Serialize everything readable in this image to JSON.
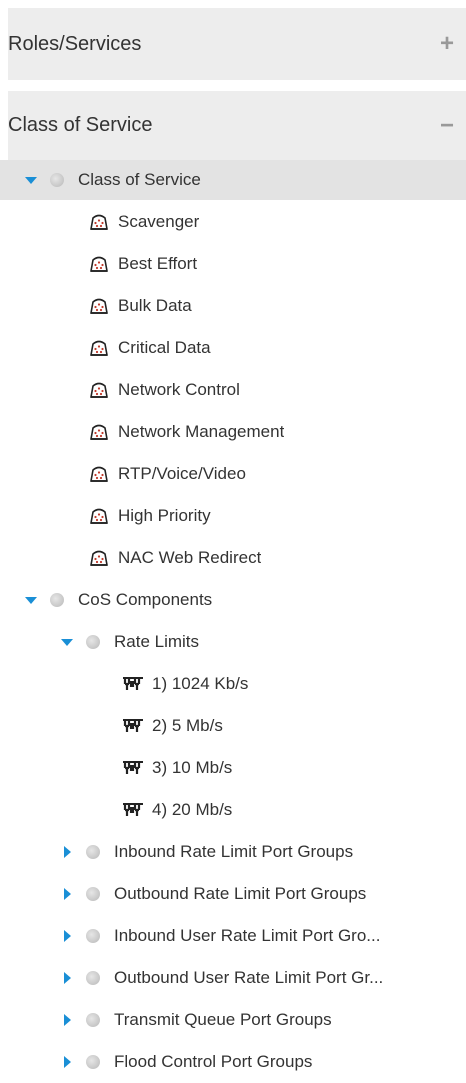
{
  "panels": {
    "roles_services": {
      "title": "Roles/Services",
      "toggle": "+"
    },
    "class_of_service": {
      "title": "Class of Service",
      "toggle": "−"
    }
  },
  "tree": {
    "cos_root": {
      "label": "Class of Service"
    },
    "cos_items": [
      {
        "label": "Scavenger"
      },
      {
        "label": "Best Effort"
      },
      {
        "label": "Bulk Data"
      },
      {
        "label": "Critical Data"
      },
      {
        "label": "Network Control"
      },
      {
        "label": "Network Management"
      },
      {
        "label": "RTP/Voice/Video"
      },
      {
        "label": "High Priority"
      },
      {
        "label": "NAC Web Redirect"
      }
    ],
    "components": {
      "label": "CoS Components"
    },
    "rate_limits": {
      "label": "Rate Limits"
    },
    "rate_limit_items": [
      {
        "label": "1) 1024 Kb/s"
      },
      {
        "label": "2) 5 Mb/s"
      },
      {
        "label": "3) 10 Mb/s"
      },
      {
        "label": "4) 20 Mb/s"
      }
    ],
    "port_groups": [
      {
        "label": "Inbound Rate Limit Port Groups"
      },
      {
        "label": "Outbound Rate Limit Port Groups"
      },
      {
        "label": "Inbound User Rate Limit Port Gro..."
      },
      {
        "label": "Outbound User Rate Limit Port Gr..."
      },
      {
        "label": "Transmit Queue Port Groups"
      },
      {
        "label": "Flood Control Port Groups"
      }
    ]
  },
  "colors": {
    "arrow": "#1a8fd6",
    "header_bg": "#ededed",
    "selected_bg": "#e3e3e3"
  }
}
